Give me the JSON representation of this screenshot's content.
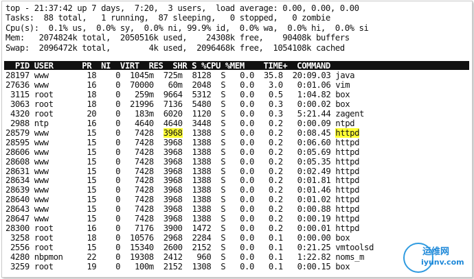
{
  "summary": [
    "top - 21:37:42 up 7 days,  7:20,  3 users,  load average: 0.00, 0.00, 0.00",
    "Tasks:  88 total,   1 running,  87 sleeping,   0 stopped,   0 zombie",
    "Cpu(s):  0.1% us,  0.0% sy,  0.0% ni, 99.9% id,  0.0% wa,  0.0% hi,  0.0% si",
    "Mem:   2074824k total,  2050516k used,    24308k free,    90408k buffers",
    "Swap:  2096472k total,        4k used,  2096468k free,  1054108k cached"
  ],
  "header": "  PID USER      PR  NI  VIRT  RES  SHR S %CPU %MEM    TIME+  COMMAND",
  "processes": [
    {
      "pid": "28197",
      "user": "www",
      "pr": "18",
      "ni": "0",
      "virt": "1045m",
      "res": "725m",
      "shr": "8128",
      "s": "S",
      "cpu": "0.0",
      "mem": "35.8",
      "time": "20:09.03",
      "command": "java"
    },
    {
      "pid": "27636",
      "user": "www",
      "pr": "16",
      "ni": "0",
      "virt": "70000",
      "res": "60m",
      "shr": "2048",
      "s": "S",
      "cpu": "0.0",
      "mem": "3.0",
      "time": "0:01.06",
      "command": "vim"
    },
    {
      "pid": "3115",
      "user": "root",
      "pr": "18",
      "ni": "0",
      "virt": "259m",
      "res": "9664",
      "shr": "5312",
      "s": "S",
      "cpu": "0.0",
      "mem": "0.5",
      "time": "1:04.82",
      "command": "box"
    },
    {
      "pid": "3063",
      "user": "root",
      "pr": "18",
      "ni": "0",
      "virt": "21996",
      "res": "7136",
      "shr": "5480",
      "s": "S",
      "cpu": "0.0",
      "mem": "0.3",
      "time": "0:00.02",
      "command": "box"
    },
    {
      "pid": "4320",
      "user": "root",
      "pr": "20",
      "ni": "0",
      "virt": "183m",
      "res": "6020",
      "shr": "1120",
      "s": "S",
      "cpu": "0.0",
      "mem": "0.3",
      "time": "5:21.44",
      "command": "zagent"
    },
    {
      "pid": "2988",
      "user": "ntp",
      "pr": "16",
      "ni": "0",
      "virt": "4640",
      "res": "4640",
      "shr": "3448",
      "s": "S",
      "cpu": "0.0",
      "mem": "0.2",
      "time": "0:00.09",
      "command": "ntpd"
    },
    {
      "pid": "28579",
      "user": "www",
      "pr": "15",
      "ni": "0",
      "virt": "7428",
      "res": "3968",
      "shr": "1388",
      "s": "S",
      "cpu": "0.0",
      "mem": "0.2",
      "time": "0:08.45",
      "command": "httpd"
    },
    {
      "pid": "28595",
      "user": "www",
      "pr": "15",
      "ni": "0",
      "virt": "7428",
      "res": "3968",
      "shr": "1388",
      "s": "S",
      "cpu": "0.0",
      "mem": "0.2",
      "time": "0:06.60",
      "command": "httpd"
    },
    {
      "pid": "28606",
      "user": "www",
      "pr": "15",
      "ni": "0",
      "virt": "7428",
      "res": "3968",
      "shr": "1388",
      "s": "S",
      "cpu": "0.0",
      "mem": "0.2",
      "time": "0:05.69",
      "command": "httpd"
    },
    {
      "pid": "28608",
      "user": "www",
      "pr": "15",
      "ni": "0",
      "virt": "7428",
      "res": "3968",
      "shr": "1388",
      "s": "S",
      "cpu": "0.0",
      "mem": "0.2",
      "time": "0:05.35",
      "command": "httpd"
    },
    {
      "pid": "28631",
      "user": "www",
      "pr": "15",
      "ni": "0",
      "virt": "7428",
      "res": "3968",
      "shr": "1388",
      "s": "S",
      "cpu": "0.0",
      "mem": "0.2",
      "time": "0:02.49",
      "command": "httpd"
    },
    {
      "pid": "28634",
      "user": "www",
      "pr": "15",
      "ni": "0",
      "virt": "7428",
      "res": "3968",
      "shr": "1388",
      "s": "S",
      "cpu": "0.0",
      "mem": "0.2",
      "time": "0:01.81",
      "command": "httpd"
    },
    {
      "pid": "28639",
      "user": "www",
      "pr": "15",
      "ni": "0",
      "virt": "7428",
      "res": "3968",
      "shr": "1388",
      "s": "S",
      "cpu": "0.0",
      "mem": "0.2",
      "time": "0:01.46",
      "command": "httpd"
    },
    {
      "pid": "28640",
      "user": "www",
      "pr": "15",
      "ni": "0",
      "virt": "7428",
      "res": "3968",
      "shr": "1388",
      "s": "S",
      "cpu": "0.0",
      "mem": "0.2",
      "time": "0:01.02",
      "command": "httpd"
    },
    {
      "pid": "28643",
      "user": "www",
      "pr": "15",
      "ni": "0",
      "virt": "7428",
      "res": "3968",
      "shr": "1388",
      "s": "S",
      "cpu": "0.0",
      "mem": "0.2",
      "time": "0:00.88",
      "command": "httpd"
    },
    {
      "pid": "28647",
      "user": "www",
      "pr": "15",
      "ni": "0",
      "virt": "7428",
      "res": "3968",
      "shr": "1388",
      "s": "S",
      "cpu": "0.0",
      "mem": "0.2",
      "time": "0:00.19",
      "command": "httpd"
    },
    {
      "pid": "28300",
      "user": "root",
      "pr": "16",
      "ni": "0",
      "virt": "7176",
      "res": "3900",
      "shr": "1472",
      "s": "S",
      "cpu": "0.0",
      "mem": "0.2",
      "time": "0:00.01",
      "command": "httpd"
    },
    {
      "pid": "3258",
      "user": "root",
      "pr": "18",
      "ni": "0",
      "virt": "10576",
      "res": "2968",
      "shr": "2284",
      "s": "S",
      "cpu": "0.0",
      "mem": "0.1",
      "time": "0:00.00",
      "command": "box"
    },
    {
      "pid": "2556",
      "user": "root",
      "pr": "15",
      "ni": "0",
      "virt": "15340",
      "res": "2600",
      "shr": "2152",
      "s": "S",
      "cpu": "0.0",
      "mem": "0.1",
      "time": "0:21.25",
      "command": "vmtoolsd"
    },
    {
      "pid": "4280",
      "user": "nbpmon",
      "pr": "22",
      "ni": "0",
      "virt": "19308",
      "res": "2412",
      "shr": "960",
      "s": "S",
      "cpu": "0.0",
      "mem": "0.1",
      "time": "1:22.82",
      "command": "noms_m"
    },
    {
      "pid": "3259",
      "user": "root",
      "pr": "19",
      "ni": "0",
      "virt": "100m",
      "res": "2152",
      "shr": "1308",
      "s": "S",
      "cpu": "0.0",
      "mem": "0.1",
      "time": "0:00.15",
      "command": "box"
    }
  ],
  "highlight": {
    "row": 6,
    "fields": [
      "res",
      "command"
    ],
    "color": "#ffff33"
  },
  "watermark": {
    "line1": "运维网",
    "line2": "iyunv.com",
    "color": "#1e88d8"
  },
  "colors": {
    "header_bg": "#111111",
    "header_text": "#ffffff",
    "text": "#111111",
    "background": "#ffffff"
  }
}
